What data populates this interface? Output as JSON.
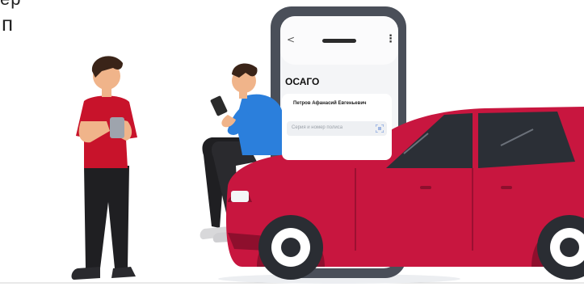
{
  "corner": {
    "partial_text": "ер   ",
    "glyph": "п"
  },
  "phone": {
    "back_icon": "chevron-left-icon",
    "menu_icon": "more-vertical-icon",
    "title": "ОСАГО",
    "holder_name": "Петров Афанасий Евгеньевич",
    "policy_input_placeholder": "Серия и номер полиса",
    "scan_icon": "scan-icon"
  },
  "colors": {
    "car_body": "#c8163f",
    "car_dark": "#8e0f2d",
    "shirt_red": "#c8132b",
    "shirt_blue": "#2b7fdc",
    "pants": "#1f1f22",
    "skin": "#f0b48a",
    "hair": "#3a2418",
    "phone_frame": "#4a4f59",
    "phone_screen": "#f4f5f7"
  }
}
